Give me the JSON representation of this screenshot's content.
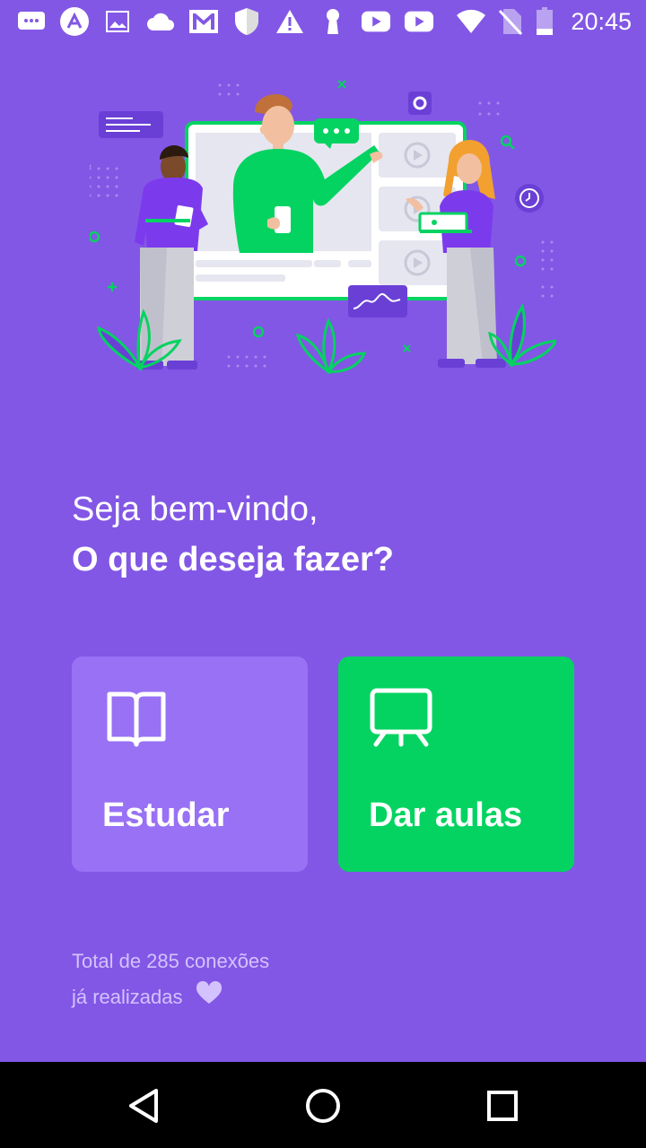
{
  "status_bar": {
    "time": "20:45",
    "icons": [
      "chat-icon",
      "app-a-icon",
      "image-icon",
      "cloud-icon",
      "gmail-icon",
      "shield-icon",
      "warning-icon",
      "keyhole-icon",
      "youtube-icon",
      "youtube-icon",
      "wifi-icon",
      "no-sim-icon",
      "battery-icon"
    ]
  },
  "hero": {
    "illustration": "landing-illustration"
  },
  "greeting": {
    "line1": "Seja bem-vindo,",
    "line2": "O que deseja fazer?"
  },
  "actions": {
    "study": {
      "label": "Estudar",
      "icon": "book-icon",
      "color": "#9871F5"
    },
    "teach": {
      "label": "Dar aulas",
      "icon": "presentation-icon",
      "color": "#04D361"
    }
  },
  "connections": {
    "line1": "Total de 285 conexões",
    "line2": "já realizadas",
    "icon": "heart-icon"
  },
  "nav": {
    "back": "back-icon",
    "home": "home-icon",
    "recents": "recents-icon"
  },
  "colors": {
    "background": "#8257E5",
    "accent_green": "#04D361",
    "card_purple": "#9871F5"
  }
}
